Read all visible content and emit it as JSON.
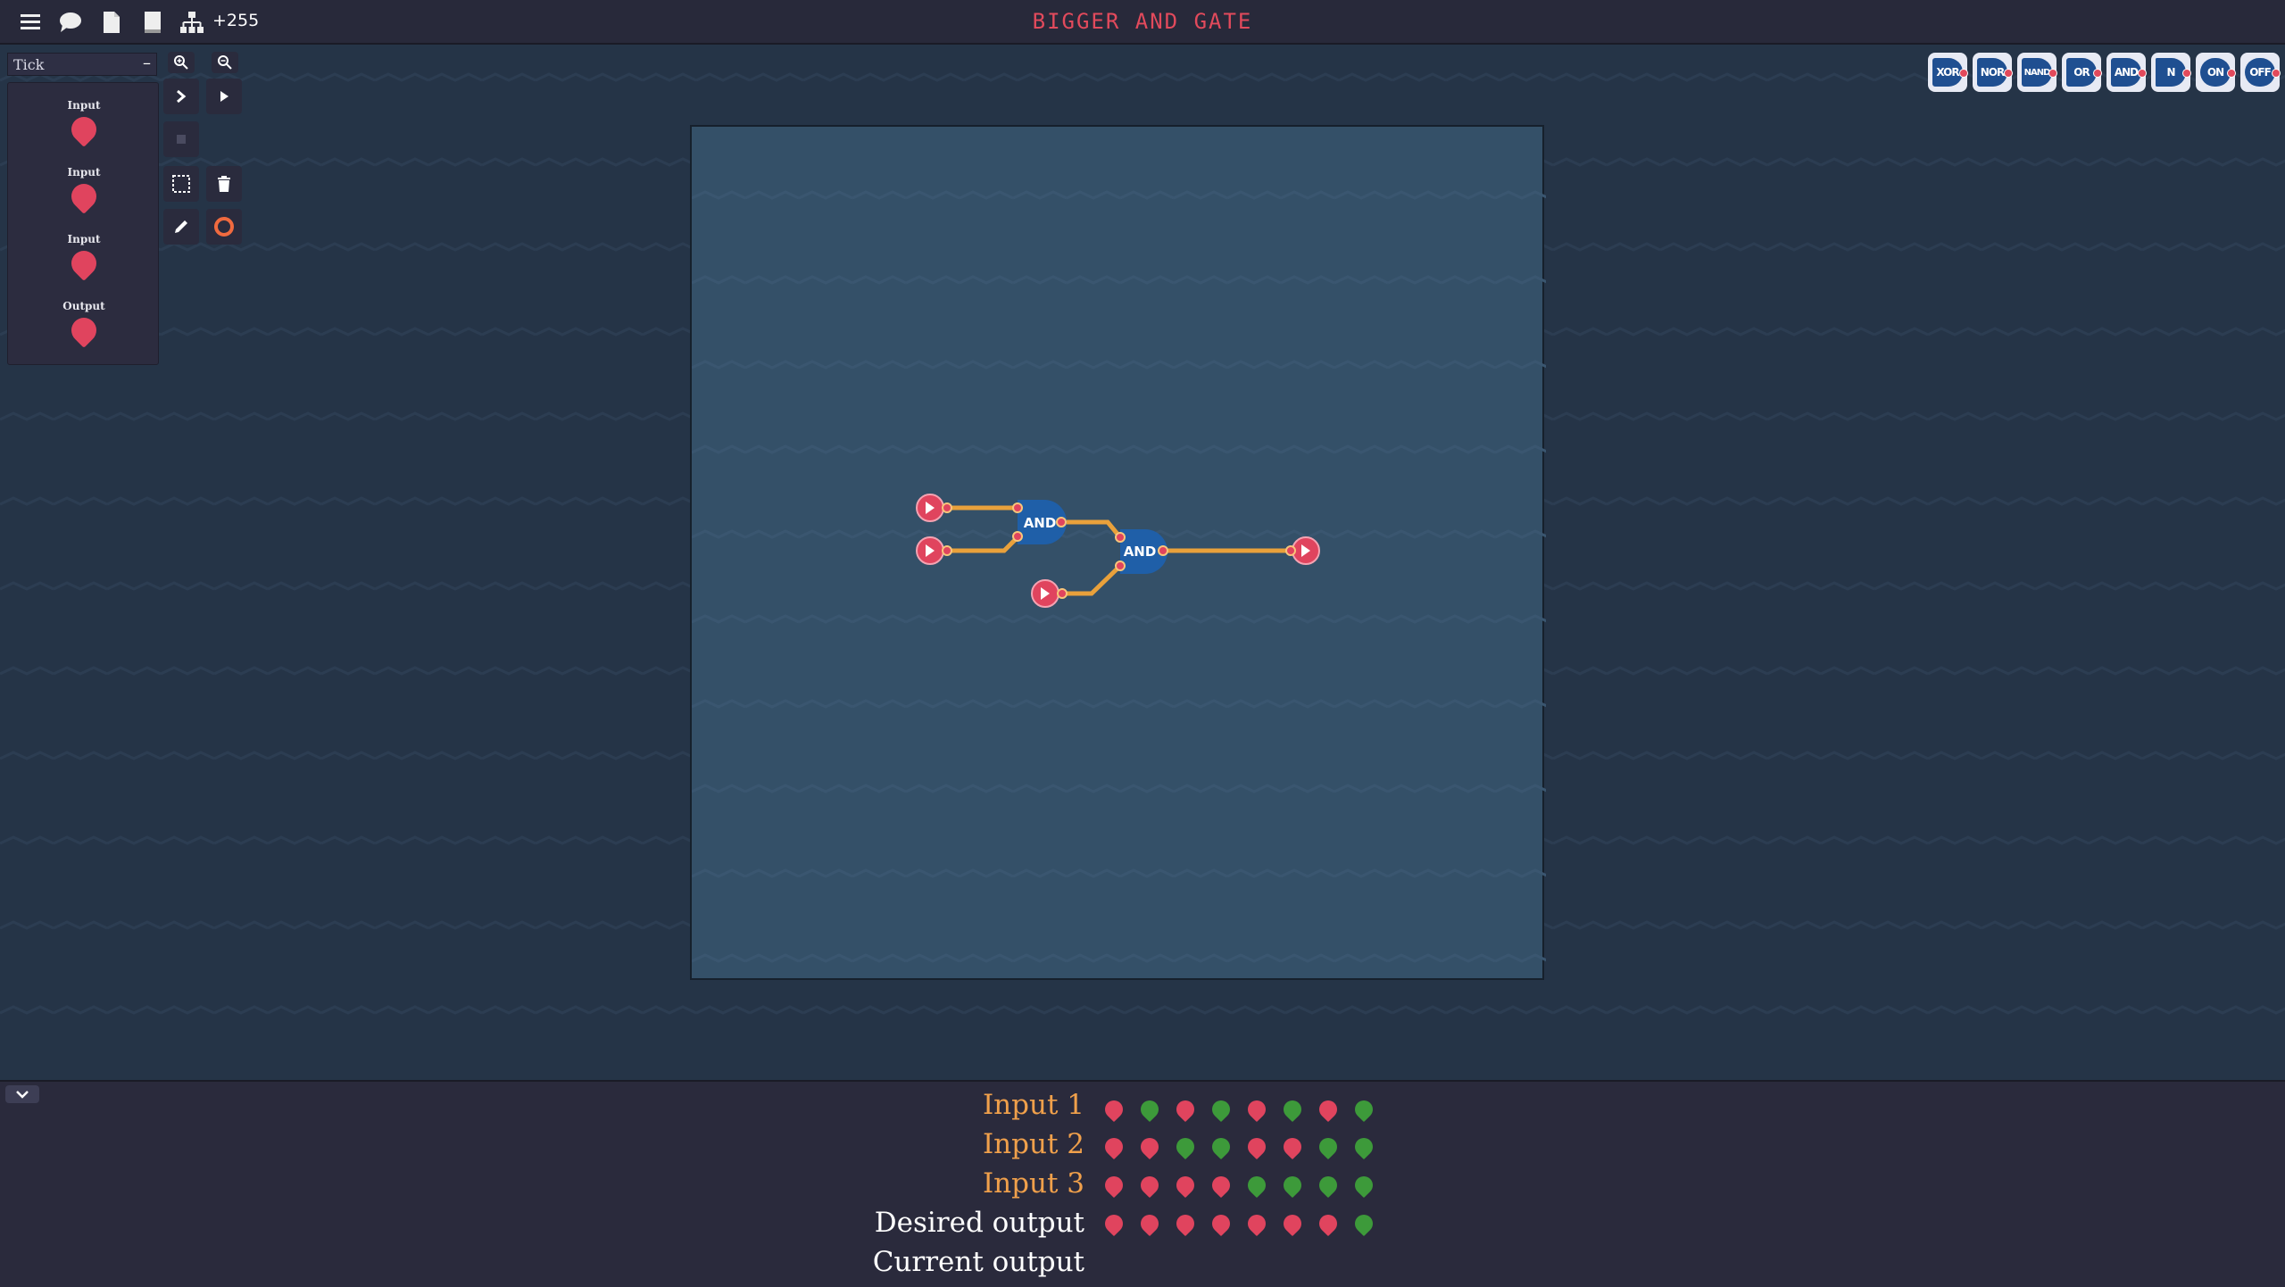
{
  "header": {
    "title": "BIGGER AND GATE",
    "counter": "+255",
    "icons": [
      "menu-icon",
      "chat-icon",
      "file-icon",
      "book-icon",
      "hierarchy-icon"
    ]
  },
  "left_panel": {
    "tick_select": {
      "value": "Tick",
      "caret": "–"
    },
    "io_items": [
      {
        "label": "Input"
      },
      {
        "label": "Input"
      },
      {
        "label": "Input"
      },
      {
        "label": "Output"
      }
    ]
  },
  "toolbar": {
    "tools": [
      "zoom-in-icon",
      "zoom-out-icon",
      "step-icon",
      "play-icon",
      "stop-icon",
      "select-icon",
      "trash-icon",
      "pencil-icon",
      "ring-icon"
    ]
  },
  "palette": {
    "gates": [
      "XOR",
      "NOR",
      "NAND",
      "OR",
      "AND",
      "N",
      "ON",
      "OFF"
    ]
  },
  "circuit": {
    "gates": [
      {
        "label": "AND"
      },
      {
        "label": "AND"
      }
    ]
  },
  "truth_table": {
    "rows": [
      {
        "label": "Input 1",
        "values": [
          0,
          1,
          0,
          1,
          0,
          1,
          0,
          1
        ]
      },
      {
        "label": "Input 2",
        "values": [
          0,
          0,
          1,
          1,
          0,
          0,
          1,
          1
        ]
      },
      {
        "label": "Input 3",
        "values": [
          0,
          0,
          0,
          0,
          1,
          1,
          1,
          1
        ]
      },
      {
        "label": "Desired output",
        "values": [
          0,
          0,
          0,
          0,
          0,
          0,
          0,
          1
        ]
      },
      {
        "label": "Current output",
        "values": []
      }
    ]
  },
  "colors": {
    "off": "#e0445e",
    "on": "#3d9a3a",
    "wire": "#e9a13b",
    "title": "#e24a5c",
    "gate": "#1f4f91"
  }
}
